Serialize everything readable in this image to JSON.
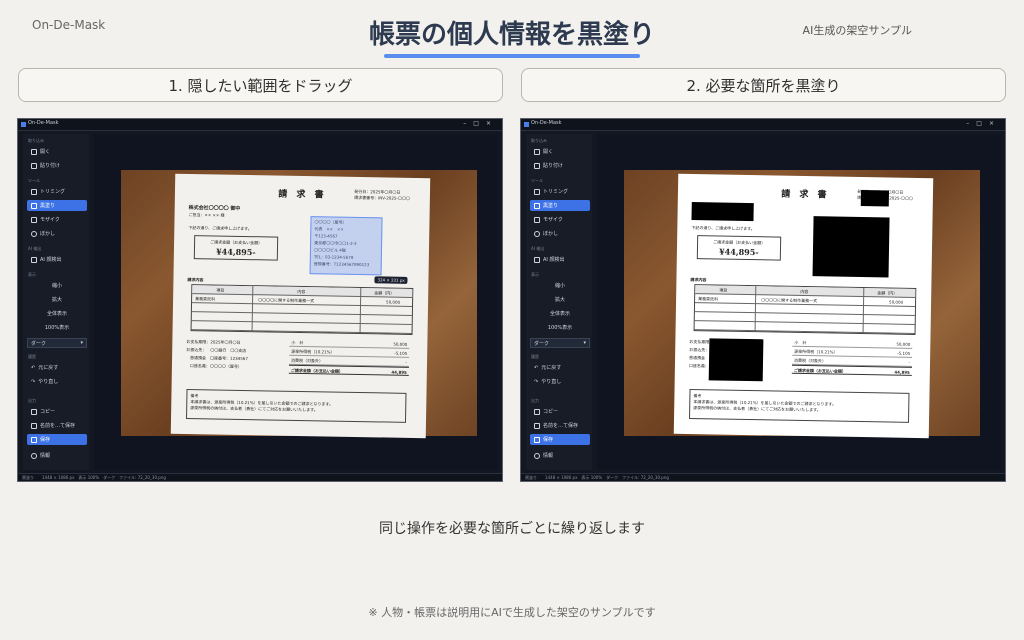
{
  "header": {
    "brand": "On-De-Mask",
    "title": "帳票の個人情報を黒塗り",
    "subnote": "AI生成の架空サンプル"
  },
  "steps": [
    {
      "label": "1. 隠したい範囲をドラッグ"
    },
    {
      "label": "2. 必要な箇所を黒塗り"
    }
  ],
  "app": {
    "window_title": "On-De-Mask",
    "sections": {
      "load": "取り込み",
      "tools": "ツール",
      "ai": "AI 検出",
      "view": "表示",
      "history": "履歴",
      "output": "出力"
    },
    "items": {
      "open": "開く",
      "paste": "貼り付け",
      "trim": "トリミング",
      "blackout": "黒塗り",
      "mosaic": "モザイク",
      "blur": "ぼかし",
      "ai_detect": "AI 顔検出",
      "zoom_out": "縮小",
      "zoom_in": "拡大",
      "fit": "全体表示",
      "actual": "100%表示",
      "theme": "ダーク",
      "undo": "元に戻す",
      "redo": "やり直し",
      "copy": "コピー",
      "save_as": "名前を…て保存",
      "save": "保存",
      "info": "情報"
    },
    "status": "黒塗り　　1448 × 1086 px　表示 100%　ダーク　ファイル: 72_20_30.png",
    "selection_size": "324 × 231 px"
  },
  "invoice": {
    "title": "請 求 書",
    "meta": [
      "発行日：2025年〇月〇日",
      "請求書番号：INV-2025-〇〇〇"
    ],
    "company": "株式会社〇〇〇〇 御中",
    "person": "ご担当：×× ×× 様",
    "intro": "下記の通り、ご請求申し上げます。",
    "amount_label": "ご請求金額（お支払い金額）",
    "amount": "¥44,895-",
    "sender": [
      "〇〇〇〇（屋号）",
      "代表　××　××",
      "〒123-4567",
      "東京都〇〇市〇〇1-2-3",
      "〇〇〇〇ビル 4階",
      "TEL：03-1234-5678",
      "登録番号：T1234567890123"
    ],
    "section": "請求内容",
    "table_headers": [
      "項目",
      "内容",
      "金額（円）"
    ],
    "table_row": [
      "業務委託料",
      "〇〇〇〇に関する制作業務一式",
      "50,000"
    ],
    "payment": [
      "お支払期限：2025年〇月〇日",
      "お振込先：　〇〇銀行　〇〇支店",
      "　普通預金　口座番号：1234567",
      "　口座名義：〇〇〇〇（屋号）"
    ],
    "totals": [
      {
        "label": "小　計",
        "value": "50,000"
      },
      {
        "label": "源泉所得税（10.21%）",
        "value": "-5,105"
      },
      {
        "label": "消費税（対象外）",
        "value": "-"
      },
      {
        "label": "ご請求金額（お支払い金額）",
        "value": "44,895"
      }
    ],
    "notes_title": "備考",
    "notes": [
      "本請求書は、源泉所得税（10.21%）を差し引いた金額でのご請求となります。",
      "源泉所得税の納付は、支払者（貴社）にてご対応をお願いいたします。"
    ]
  },
  "caption": "同じ操作を必要な箇所ごとに繰り返します",
  "footnote": "※ 人物・帳票は説明用にAIで生成した架空のサンプルです"
}
